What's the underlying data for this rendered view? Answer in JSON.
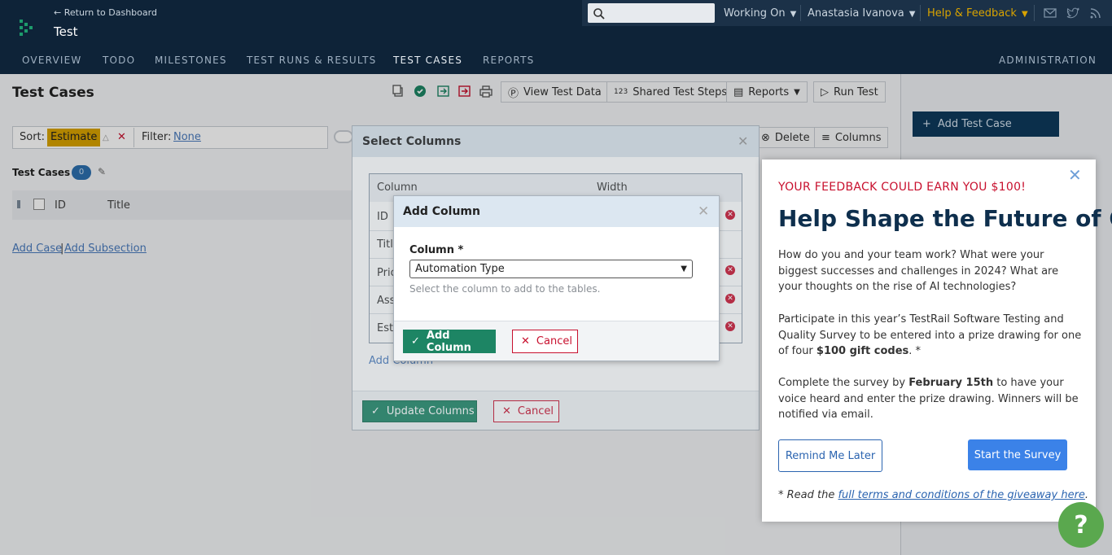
{
  "header": {
    "back_link": "← Return to Dashboard",
    "project_title": "Test",
    "search": {
      "placeholder": ""
    },
    "working_on": "Working On",
    "user": "Anastasia Ivanova",
    "help": "Help & Feedback",
    "colors": {
      "bg": "#0e2338",
      "help": "#d8a300"
    }
  },
  "nav": {
    "tabs": [
      "OVERVIEW",
      "TODO",
      "MILESTONES",
      "TEST RUNS & RESULTS",
      "TEST CASES",
      "REPORTS"
    ],
    "active": "TEST CASES",
    "admin": "ADMINISTRATION"
  },
  "page": {
    "title": "Test Cases",
    "toolbar": {
      "view_test_data": "View Test Data",
      "shared_test_steps": "Shared Test Steps",
      "reports": "Reports",
      "run_test": "Run Test",
      "delete": "Delete",
      "columns": "Columns"
    },
    "sort_label": "Sort:",
    "sort_value": "Estimate",
    "filter_label": "Filter:",
    "filter_value": "None",
    "section_title": "Test Cases",
    "section_count": "0",
    "list_columns": [
      "ID",
      "Title"
    ],
    "add_case": "Add Case",
    "add_separator": "|",
    "add_subsection": "Add Subsection",
    "add_test_case": "Add Test Case"
  },
  "select_columns": {
    "title": "Select Columns",
    "headers": [
      "Column",
      "Width"
    ],
    "rows": [
      "ID",
      "Title",
      "Priority",
      "Assigned To",
      "Estimate"
    ],
    "add_column_link": "Add Column",
    "update_button": "Update Columns",
    "cancel_button": "Cancel"
  },
  "add_column": {
    "title": "Add Column",
    "label": "Column *",
    "selected": "Automation Type",
    "help": "Select the column to add to the tables.",
    "add_button": "Add Column",
    "cancel_button": "Cancel"
  },
  "survey": {
    "kicker": "YOUR FEEDBACK COULD EARN YOU $100!",
    "title": "Help Shape the Future of QA",
    "p1": "How do you and your team work? What were your biggest successes and challenges in 2024? What are your thoughts on the rise of AI technologies?",
    "p2_a": "Participate in this year’s TestRail Software Testing and Quality Survey to be entered into a prize drawing for one of four ",
    "p2_b": "$100 gift codes",
    "p2_c": ". *",
    "p3_a": "Complete the survey by ",
    "p3_b": "February 15th",
    "p3_c": " to have your voice heard and enter the prize drawing. Winners will be notified via email.",
    "remind": "Remind Me Later",
    "start": "Start the Survey",
    "terms_prefix": "* Read the ",
    "terms_link": "full terms and conditions of the giveaway here",
    "terms_suffix": ".",
    "accent": "#3b82e8"
  },
  "help_bubble": "?"
}
